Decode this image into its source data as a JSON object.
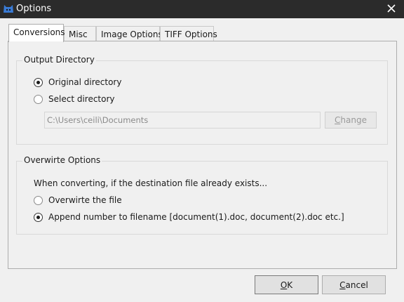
{
  "window": {
    "title": "Options",
    "close_icon": "close-icon"
  },
  "tabs": [
    {
      "label": "Conversions",
      "active": true
    },
    {
      "label": "Misc",
      "active": false
    },
    {
      "label": "Image Options",
      "active": false
    },
    {
      "label": "TIFF Options",
      "active": false
    }
  ],
  "output_directory": {
    "legend": "Output Directory",
    "options": [
      {
        "label": "Original directory",
        "checked": true
      },
      {
        "label": "Select directory",
        "checked": false
      }
    ],
    "path_value": "C:\\Users\\ceili\\Documents",
    "change_button": {
      "prefix": "",
      "accel": "C",
      "rest": "hange"
    }
  },
  "overwrite_options": {
    "legend": "Overwirte Options",
    "description": "When converting, if the destination file already exists...",
    "options": [
      {
        "label": "Overwirte the file",
        "checked": false
      },
      {
        "label": "Append number to filename  [document(1).doc, document(2).doc etc.]",
        "checked": true
      }
    ]
  },
  "buttons": {
    "ok": {
      "accel": "O",
      "rest": "K"
    },
    "cancel": {
      "accel": "C",
      "rest": "ancel"
    }
  },
  "colors": {
    "titlebar": "#2b2b2b",
    "app_icon": "#3a7bd5"
  }
}
